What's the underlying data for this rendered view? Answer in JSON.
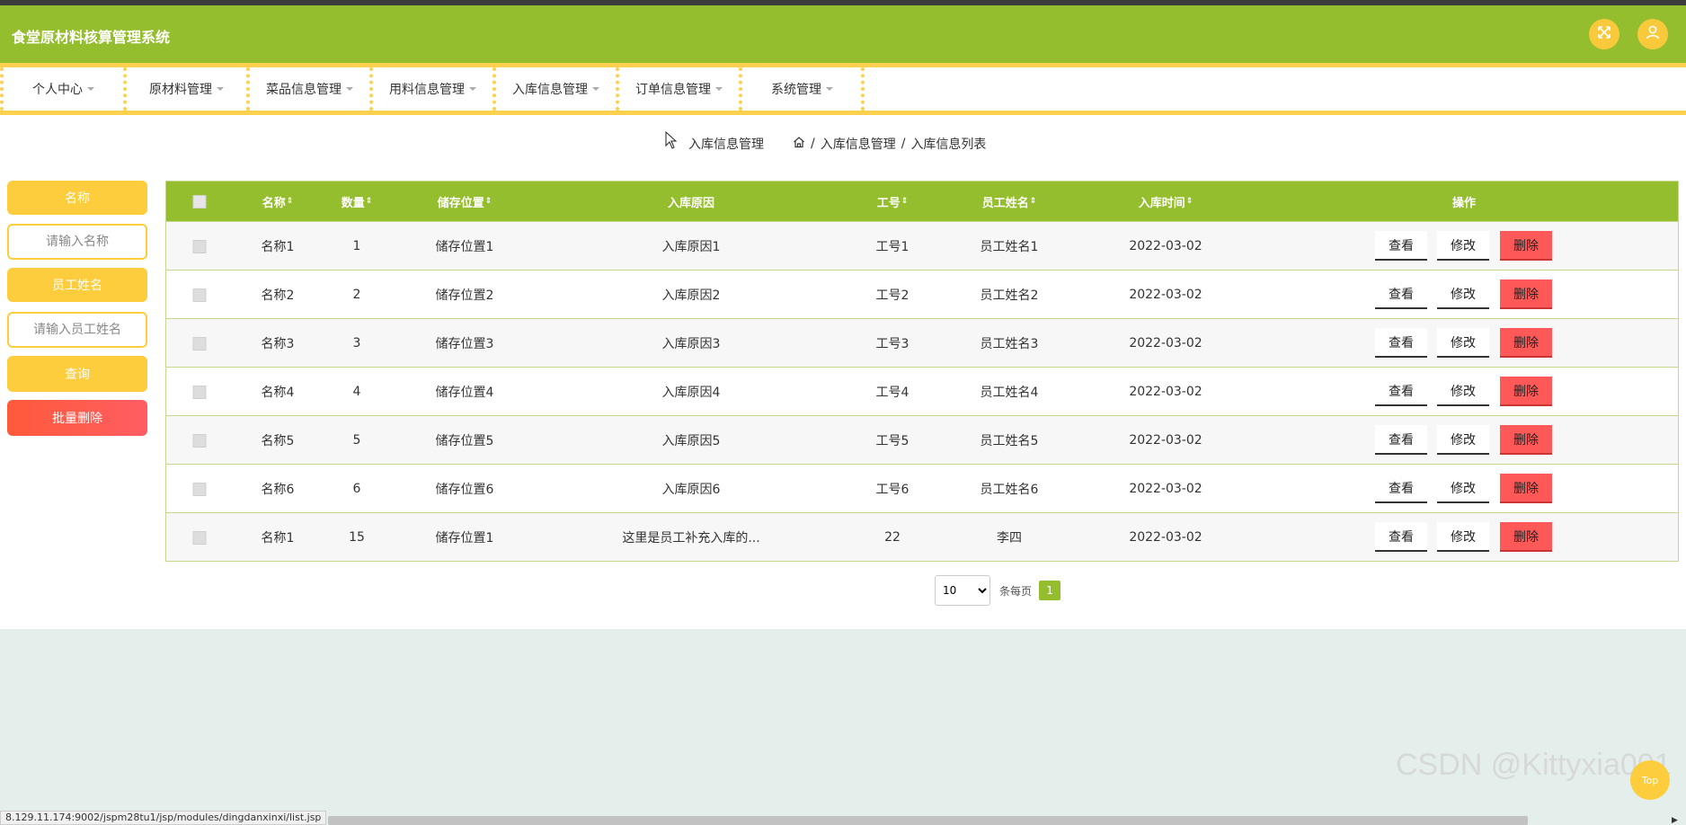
{
  "app": {
    "title": "食堂原材料核算管理系统"
  },
  "header_icons": {
    "fullscreen": "expand-icon",
    "user": "user-icon"
  },
  "nav": {
    "items": [
      {
        "label": "个人中心"
      },
      {
        "label": "原材料管理"
      },
      {
        "label": "菜品信息管理"
      },
      {
        "label": "用料信息管理"
      },
      {
        "label": "入库信息管理"
      },
      {
        "label": "订单信息管理"
      },
      {
        "label": "系统管理"
      }
    ]
  },
  "page": {
    "title": "入库信息管理",
    "breadcrumb": {
      "sep": "/",
      "level1": "入库信息管理",
      "level2": "入库信息列表"
    }
  },
  "search": {
    "name_label": "名称",
    "name_placeholder": "请输入名称",
    "employee_label": "员工姓名",
    "employee_placeholder": "请输入员工姓名",
    "query_button": "查询",
    "batch_delete_button": "批量删除"
  },
  "table": {
    "columns": [
      "名称",
      "数量",
      "储存位置",
      "入库原因",
      "工号",
      "员工姓名",
      "入库时间",
      "操作"
    ],
    "sort_icon": "⇕",
    "rows": [
      {
        "name": "名称1",
        "qty": "1",
        "location": "储存位置1",
        "reason": "入库原因1",
        "emp_no": "工号1",
        "emp_name": "员工姓名1",
        "time": "2022-03-02"
      },
      {
        "name": "名称2",
        "qty": "2",
        "location": "储存位置2",
        "reason": "入库原因2",
        "emp_no": "工号2",
        "emp_name": "员工姓名2",
        "time": "2022-03-02"
      },
      {
        "name": "名称3",
        "qty": "3",
        "location": "储存位置3",
        "reason": "入库原因3",
        "emp_no": "工号3",
        "emp_name": "员工姓名3",
        "time": "2022-03-02"
      },
      {
        "name": "名称4",
        "qty": "4",
        "location": "储存位置4",
        "reason": "入库原因4",
        "emp_no": "工号4",
        "emp_name": "员工姓名4",
        "time": "2022-03-02"
      },
      {
        "name": "名称5",
        "qty": "5",
        "location": "储存位置5",
        "reason": "入库原因5",
        "emp_no": "工号5",
        "emp_name": "员工姓名5",
        "time": "2022-03-02"
      },
      {
        "name": "名称6",
        "qty": "6",
        "location": "储存位置6",
        "reason": "入库原因6",
        "emp_no": "工号6",
        "emp_name": "员工姓名6",
        "time": "2022-03-02"
      },
      {
        "name": "名称1",
        "qty": "15",
        "location": "储存位置1",
        "reason": "这里是员工补充入库的...",
        "emp_no": "22",
        "emp_name": "李四",
        "time": "2022-03-02"
      }
    ],
    "actions": {
      "view": "查看",
      "edit": "修改",
      "delete": "删除"
    }
  },
  "pagination": {
    "page_size": "10",
    "per_page_label": "条每页",
    "current_page": "1"
  },
  "status_url": "8.129.11.174:9002/jspm28tu1/jsp/modules/dingdanxinxi/list.jsp",
  "top_button": "Top",
  "watermark": "CSDN @Kittyxia001"
}
